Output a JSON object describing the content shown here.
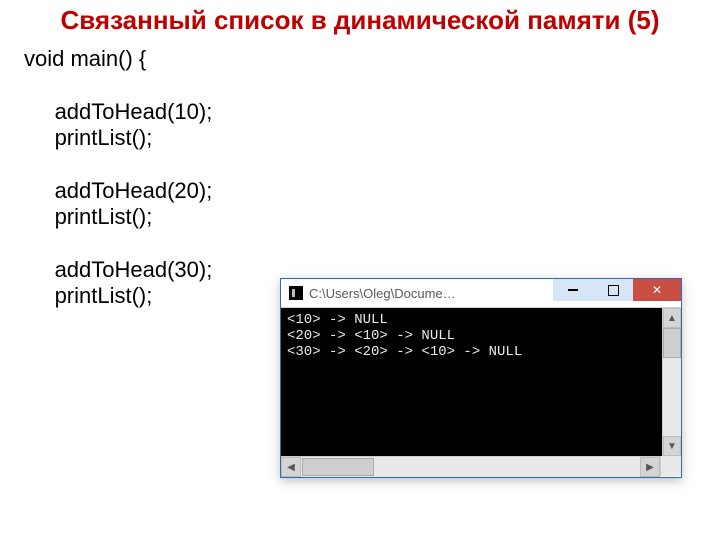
{
  "title": "Связанный список в динамической памяти (5)",
  "code": {
    "l1": "void main() {",
    "l3": "addToHead(10);",
    "l4": "printList();",
    "l6": "addToHead(20);",
    "l7": "printList();",
    "l9": "addToHead(30);",
    "l10": "printList();"
  },
  "console": {
    "title": "C:\\Users\\Oleg\\Docume…",
    "lines": {
      "r1": "<10> -> NULL",
      "r2": "<20> -> <10> -> NULL",
      "r3": "<30> -> <20> -> <10> -> NULL"
    }
  }
}
